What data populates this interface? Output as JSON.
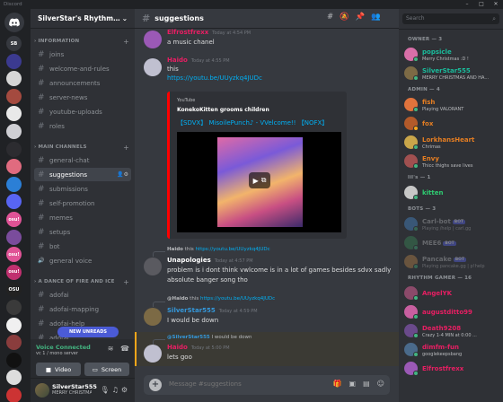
{
  "window": {
    "title": "Discord",
    "controls": [
      "–",
      "□",
      "✕"
    ]
  },
  "rail": {
    "home": "",
    "servers": [
      {
        "label": "SB",
        "color": "#36393f"
      },
      {
        "label": "",
        "color": "#3b3a8f"
      },
      {
        "label": "",
        "color": "#d6d6d6"
      },
      {
        "label": "",
        "color": "#a44a3f"
      },
      {
        "label": "",
        "color": "#e9e9e9"
      },
      {
        "label": "",
        "color": "#cfcfd4"
      },
      {
        "label": "",
        "color": "#2c2c30"
      },
      {
        "label": "",
        "color": "#e06b7f"
      },
      {
        "label": "",
        "color": "#2b7fd6"
      },
      {
        "label": "",
        "color": "#5865f2"
      },
      {
        "label": "osu!",
        "color": "#e05396"
      },
      {
        "label": "",
        "color": "#7a4c9c"
      },
      {
        "label": "osu!",
        "color": "#e05396"
      },
      {
        "label": "osu!",
        "color": "#c0306f"
      },
      {
        "label": "OSU",
        "color": "#222"
      },
      {
        "label": "",
        "color": "#3a3a3a"
      },
      {
        "label": "",
        "color": "#f0f0f0"
      },
      {
        "label": "",
        "color": "#8a3d3d"
      },
      {
        "label": "",
        "color": "#111"
      },
      {
        "label": "",
        "color": "#ddd"
      },
      {
        "label": "",
        "color": "#c33"
      }
    ]
  },
  "sidebar": {
    "server_name": "SilverStar's RhythmEmporium",
    "categories": [
      {
        "label": "INFORMATION"
      },
      {
        "label": "MAIN CHANNELS"
      },
      {
        "label": "A DANCE OF FIRE AND ICE"
      }
    ],
    "info_channels": [
      "joins",
      "welcome-and-rules",
      "announcements",
      "server-news",
      "youtube-uploads",
      "roles"
    ],
    "main_channels": [
      "general-chat",
      "suggestions",
      "submissions",
      "self-promotion",
      "memes",
      "setups",
      "bot",
      "general voice"
    ],
    "adofai_channels": [
      "adofai",
      "adofai-mapping",
      "adofai-help",
      "adofai"
    ],
    "active_channel": "suggestions",
    "new_unreads": "NEW UNREADS",
    "voice": {
      "status": "Voice Connected",
      "server": "vc 1 / mono server",
      "video_label": "Video",
      "screen_label": "Screen"
    },
    "user": {
      "name": "SilverStar555",
      "status": "MERRY CHRISTMAS AND HAPPY..."
    }
  },
  "chat": {
    "channel": "suggestions",
    "messages": [
      {
        "author": "Elfrostfrexx",
        "color": "#e91e63",
        "time": "Today at 4:54 PM",
        "text": "a music chanel",
        "avatar": "#9b59b6"
      },
      {
        "author": "Haido",
        "color": "#e91e63",
        "time": "Today at 4:55 PM",
        "text": "this",
        "link": "https://youtu.be/UUyzkq4JUDc",
        "avatar": "#c0c0d0"
      },
      {
        "reply_author": "Haido",
        "reply_text": "this",
        "reply_link": "https://youtu.be/UUyzkq4JUDc",
        "author": "Unapologies",
        "color": "#ffffff",
        "time": "Today at 4:57 PM",
        "text": "problem is i dont think vwlcome is in a lot of games besides sdvx sadly",
        "text2": "absolute banger song tho",
        "avatar": "#5a5a60"
      },
      {
        "reply_author": "@Haido",
        "reply_text": "this",
        "reply_link": "https://youtu.be/UUyzkq4JUDc",
        "author": "SilverStar555",
        "color": "#3498db",
        "time": "Today at 4:59 PM",
        "text": "I would be down",
        "avatar": "#7c6a45"
      },
      {
        "reply_author": "@SilverStar555",
        "reply_text": "I would be down",
        "author": "Haido",
        "color": "#e91e63",
        "time": "Today at 5:00 PM",
        "text": "lets goo",
        "avatar": "#c0c0d0"
      }
    ],
    "embed": {
      "provider": "YouTube",
      "author": "KonekoKitten grooms children",
      "title": "【SDVX】 MisoilePunch♪ - VVelcome!! 【NOFX】"
    },
    "composer_placeholder": "Message #suggestions"
  },
  "members": {
    "search_placeholder": "Search",
    "groups": [
      {
        "label": "OWNER — 3",
        "members": [
          {
            "name": "popsicle",
            "status": "Merry Christmas :D !",
            "color": "#1abc9c",
            "avatar": "#d86fa8",
            "presence": "#43b581"
          },
          {
            "name": "SilverStar555",
            "status": "MERRY CHRISTMAS AND HA...",
            "color": "#1abc9c",
            "avatar": "#7c6a45",
            "presence": "#43b581"
          }
        ]
      },
      {
        "label": "ADMIN — 4",
        "members": [
          {
            "name": "fish",
            "status": "Playing VALORANT",
            "color": "#e67e22",
            "avatar": "#e0733c",
            "presence": "#43b581"
          },
          {
            "name": "fox",
            "status": "",
            "color": "#e67e22",
            "avatar": "#b35a2a",
            "presence": "#faa61a"
          },
          {
            "name": "LorkhansHeart",
            "status": "Chrimas",
            "color": "#e67e22",
            "avatar": "#c9a64a",
            "presence": "#43b581"
          },
          {
            "name": "Envy",
            "status": "Thicc thighs save lives",
            "color": "#e67e22",
            "avatar": "#a05050",
            "presence": "#43b581"
          }
        ]
      },
      {
        "label": "lil's — 1",
        "members": [
          {
            "name": "kitten",
            "status": "",
            "color": "#2ecc71",
            "avatar": "#c7c7c7",
            "presence": "#43b581"
          }
        ]
      },
      {
        "label": "BOTS — 3",
        "members": [
          {
            "name": "Carl-bot",
            "status": "Playing /help | carl.gg",
            "color": "#b9bbbe",
            "avatar": "#4a90d9",
            "presence": "#43b581",
            "bot": "BOT",
            "dim": true
          },
          {
            "name": "MEE6",
            "status": "",
            "color": "#b9bbbe",
            "avatar": "#3b8e5a",
            "presence": "#43b581",
            "bot": "BOT",
            "dim": true
          },
          {
            "name": "Pancake",
            "status": "Playing pancake.gg | p!help",
            "color": "#b9bbbe",
            "avatar": "#c08a4a",
            "presence": "#43b581",
            "bot": "BOT",
            "dim": true
          }
        ]
      },
      {
        "label": "RHYTHM GAMER — 16",
        "members": [
          {
            "name": "AngelYK",
            "status": "",
            "color": "#e91e63",
            "avatar": "#8b4a6a",
            "presence": "#43b581"
          },
          {
            "name": "augustditto99",
            "status": "",
            "color": "#e91e63",
            "avatar": "#c85fa0",
            "presence": "#43b581"
          },
          {
            "name": "Death9208",
            "status": "Crazy 1-4 MIN at 0:00 ...",
            "color": "#e91e63",
            "avatar": "#6a4a8b",
            "presence": "#43b581"
          },
          {
            "name": "dimfm-fun",
            "status": "googlekeepsbang",
            "color": "#e91e63",
            "avatar": "#4a6a8b",
            "presence": "#43b581"
          },
          {
            "name": "Elfrostfrexx",
            "status": "",
            "color": "#e91e63",
            "avatar": "#9b59b6",
            "presence": "#43b581"
          }
        ]
      }
    ]
  }
}
